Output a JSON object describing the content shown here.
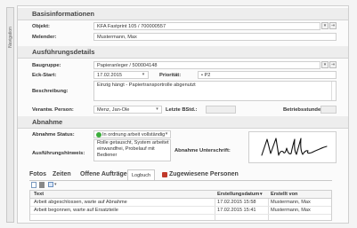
{
  "nav_label": "Navigation",
  "basis": {
    "title": "Basisinformationen",
    "objekt_label": "Objekt:",
    "objekt_value": "KFA Fastprint 105 / 700000557",
    "melder_label": "Melender:",
    "melder_value": "Mustermann, Max"
  },
  "ausf": {
    "title": "Ausführungsdetails",
    "baugruppe_label": "Baugruppe:",
    "baugruppe_value": "Papieranleger / 500004148",
    "eckstart_label": "Eck-Start:",
    "eckstart_value": "17.02.2015",
    "prio_label": "Priorität:",
    "prio_value": "• P2",
    "beschreibung_label": "Beschreibung:",
    "beschreibung_value": "Einzig hängt - Papiertransportrolle abgenutzt",
    "verantw_label": "Verantw. Person:",
    "verantw_value": "Menz, Jan-Ole",
    "letzte_label": "Letzte BStd.:",
    "betriebs_label": "Betriebsstunden:"
  },
  "abnahme": {
    "title": "Abnahme",
    "status_label": "Abnahme Status:",
    "status_value": "In ordnung arbeit vollständig",
    "hinweis_label": "Ausführungshinweis:",
    "hinweis_value": "Rolle getauscht, System arbeitet einwandfrei, Probelauf mit Bediener",
    "unterschrift_label": "Abnahme Unterschrift:"
  },
  "tabs": [
    "Fotos",
    "Zeiten",
    "Offene Aufträge",
    "Logbuch",
    "Zugewiesene Personen"
  ],
  "grid": {
    "headers": [
      "Text",
      "Erstellungsdatum",
      "Erstellt von"
    ],
    "rows": [
      [
        "Arbeit abgeschlossen, warte auf Abnahme",
        "17.02.2015 15:58",
        "Mustermann, Max"
      ],
      [
        "Arbeit begonnen, warte auf Ersatzteile",
        "17.02.2015 15:41",
        "Mustermann, Max"
      ]
    ]
  },
  "colors": {
    "status_green": "#3cae3c",
    "accent_red": "#c0392b"
  }
}
